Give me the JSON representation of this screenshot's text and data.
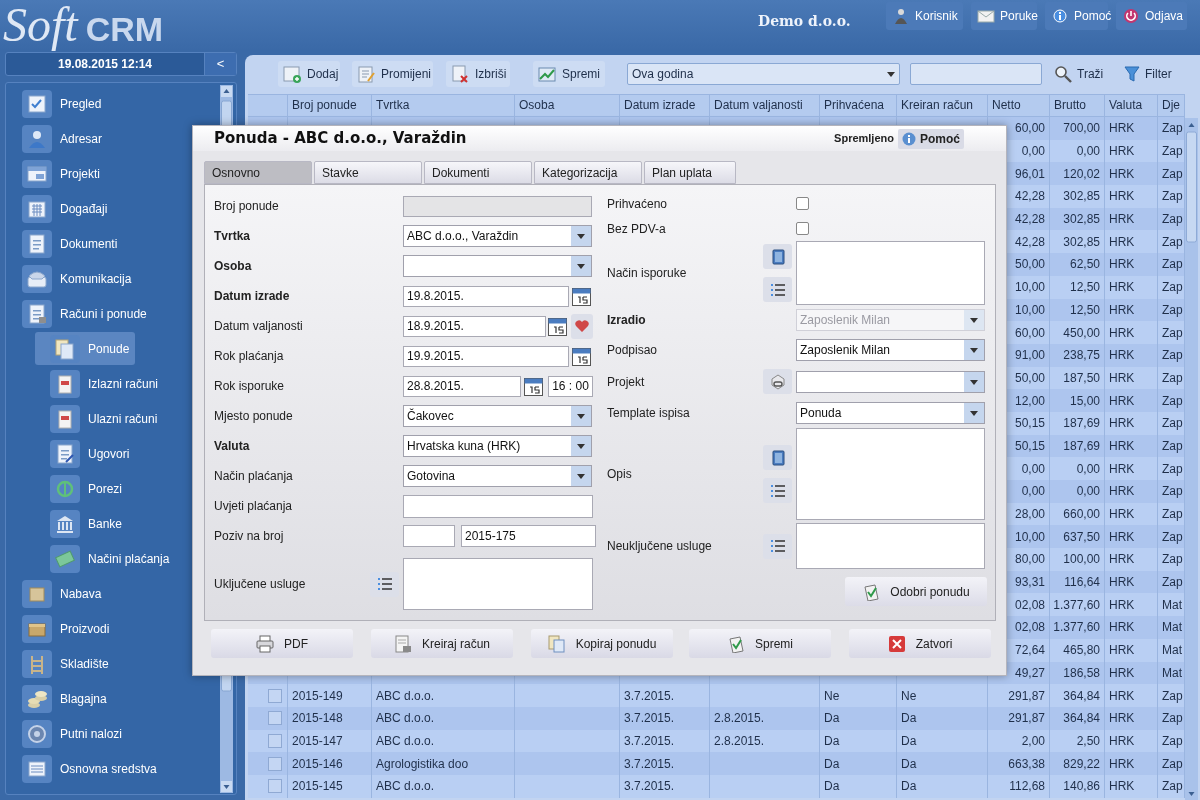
{
  "header": {
    "logo_first": "Soft",
    "logo_second": "CRM",
    "company": "Demo d.o.o.",
    "buttons": [
      "Korisnik",
      "Poruke",
      "Pomoć",
      "Odjava"
    ]
  },
  "sidebar": {
    "datetime": "19.08.2015 12:14",
    "collapse": "<",
    "items": [
      {
        "label": "Pregled",
        "selected": false
      },
      {
        "label": "Adresar",
        "selected": false
      },
      {
        "label": "Projekti",
        "selected": false
      },
      {
        "label": "Događaji",
        "selected": false
      },
      {
        "label": "Dokumenti",
        "selected": false
      },
      {
        "label": "Komunikacija",
        "selected": false
      },
      {
        "label": "Računi i ponude",
        "selected": false,
        "children": [
          {
            "label": "Ponude",
            "selected": true
          },
          {
            "label": "Izlazni računi",
            "selected": false
          },
          {
            "label": "Ulazni računi",
            "selected": false
          },
          {
            "label": "Ugovori",
            "selected": false
          },
          {
            "label": "Porezi",
            "selected": false
          },
          {
            "label": "Banke",
            "selected": false
          },
          {
            "label": "Načini plaćanja",
            "selected": false
          }
        ]
      },
      {
        "label": "Nabava",
        "selected": false
      },
      {
        "label": "Proizvodi",
        "selected": false
      },
      {
        "label": "Skladište",
        "selected": false
      },
      {
        "label": "Blagajna",
        "selected": false
      },
      {
        "label": "Putni nalozi",
        "selected": false
      },
      {
        "label": "Osnovna sredstva",
        "selected": false
      }
    ]
  },
  "toolbar": {
    "buttons": [
      "Dodaj",
      "Promijeni",
      "Izbriši",
      "Spremi"
    ],
    "period": "Ova godina",
    "search_button": "Traži",
    "filter_button": "Filter"
  },
  "table": {
    "columns": [
      "Broj ponude",
      "Tvrtka",
      "Osoba",
      "Datum izrade",
      "Datum valjanosti",
      "Prihvaćena",
      "Kreiran račun",
      "Netto",
      "Brutto",
      "Valuta",
      "Dje"
    ],
    "rows": [
      {
        "netto": "60,00",
        "brutto": "700,00",
        "valuta": "HRK",
        "dje": "Zap"
      },
      {
        "netto": "0,00",
        "brutto": "0,00",
        "valuta": "HRK",
        "dje": "Zap"
      },
      {
        "netto": "96,01",
        "brutto": "120,02",
        "valuta": "HRK",
        "dje": "Zap"
      },
      {
        "netto": "42,28",
        "brutto": "302,85",
        "valuta": "HRK",
        "dje": "Zap"
      },
      {
        "netto": "42,28",
        "brutto": "302,85",
        "valuta": "HRK",
        "dje": "Zap"
      },
      {
        "netto": "42,28",
        "brutto": "302,85",
        "valuta": "HRK",
        "dje": "Zap"
      },
      {
        "netto": "50,00",
        "brutto": "62,50",
        "valuta": "HRK",
        "dje": "Zap"
      },
      {
        "netto": "10,00",
        "brutto": "12,50",
        "valuta": "HRK",
        "dje": "Zap"
      },
      {
        "netto": "10,00",
        "brutto": "12,50",
        "valuta": "HRK",
        "dje": "Zap"
      },
      {
        "netto": "60,00",
        "brutto": "450,00",
        "valuta": "HRK",
        "dje": "Zap"
      },
      {
        "netto": "91,00",
        "brutto": "238,75",
        "valuta": "HRK",
        "dje": "Zap"
      },
      {
        "netto": "50,00",
        "brutto": "187,50",
        "valuta": "HRK",
        "dje": "Zap"
      },
      {
        "netto": "12,00",
        "brutto": "15,00",
        "valuta": "HRK",
        "dje": "Zap"
      },
      {
        "netto": "50,15",
        "brutto": "187,69",
        "valuta": "HRK",
        "dje": "Zap"
      },
      {
        "netto": "50,15",
        "brutto": "187,69",
        "valuta": "HRK",
        "dje": "Zap"
      },
      {
        "netto": "0,00",
        "brutto": "0,00",
        "valuta": "HRK",
        "dje": "Zap"
      },
      {
        "netto": "0,00",
        "brutto": "0,00",
        "valuta": "HRK",
        "dje": "Zap"
      },
      {
        "netto": "28,00",
        "brutto": "660,00",
        "valuta": "HRK",
        "dje": "Zap"
      },
      {
        "netto": "10,00",
        "brutto": "637,50",
        "valuta": "HRK",
        "dje": "Zap"
      },
      {
        "netto": "80,00",
        "brutto": "100,00",
        "valuta": "HRK",
        "dje": "Zap"
      },
      {
        "netto": "93,31",
        "brutto": "116,64",
        "valuta": "HRK",
        "dje": "Zap"
      },
      {
        "netto": "02,08",
        "brutto": "1.377,60",
        "valuta": "HRK",
        "dje": "Mat"
      },
      {
        "netto": "02,08",
        "brutto": "1.377,60",
        "valuta": "HRK",
        "dje": "Mat"
      },
      {
        "netto": "72,64",
        "brutto": "465,80",
        "valuta": "HRK",
        "dje": "Mat"
      },
      {
        "netto": "49,27",
        "brutto": "186,58",
        "valuta": "HRK",
        "dje": "Mat"
      },
      {
        "checked": false,
        "broj": "2015-149",
        "tvrtka": "ABC d.o.o.",
        "datum_izrade": "3.7.2015.",
        "prihvacena": "Ne",
        "kreiran_racun": "Ne",
        "netto": "291,87",
        "brutto": "364,84",
        "valuta": "HRK",
        "dje": "Zap"
      },
      {
        "checked": false,
        "broj": "2015-148",
        "tvrtka": "ABC d.o.o.",
        "datum_izrade": "3.7.2015.",
        "datum_valjanosti": "2.8.2015.",
        "prihvacena": "Da",
        "kreiran_racun": "Da",
        "netto": "291,87",
        "brutto": "364,84",
        "valuta": "HRK",
        "dje": "Zap"
      },
      {
        "checked": false,
        "broj": "2015-147",
        "tvrtka": "ABC d.o.o.",
        "datum_izrade": "3.7.2015.",
        "datum_valjanosti": "2.8.2015.",
        "prihvacena": "Da",
        "kreiran_racun": "Da",
        "netto": "2,00",
        "brutto": "2,50",
        "valuta": "HRK",
        "dje": "Zap"
      },
      {
        "checked": false,
        "broj": "2015-146",
        "tvrtka": "Agrologistika doo",
        "datum_izrade": "3.7.2015.",
        "prihvacena": "Da",
        "kreiran_racun": "Da",
        "netto": "663,38",
        "brutto": "829,22",
        "valuta": "HRK",
        "dje": "Zap"
      },
      {
        "checked": false,
        "broj": "2015-145",
        "tvrtka": "ABC d.o.o.",
        "datum_izrade": "3.7.2015.",
        "prihvacena": "Da",
        "kreiran_racun": "Da",
        "netto": "112,68",
        "brutto": "140,86",
        "valuta": "HRK",
        "dje": "Zap"
      }
    ]
  },
  "dialog": {
    "title": "Ponuda - ABC d.o.o., Varaždin",
    "status": "Spremljeno",
    "help": "Pomoć",
    "tabs": [
      {
        "label": "Osnovno",
        "selected": true
      },
      {
        "label": "Stavke",
        "selected": false
      },
      {
        "label": "Dokumenti",
        "selected": false
      },
      {
        "label": "Kategorizacija",
        "selected": false
      },
      {
        "label": "Plan uplata",
        "selected": false
      }
    ],
    "left_fields": [
      {
        "label": "Broj ponude",
        "required": false,
        "kind": "readonly"
      },
      {
        "label": "Tvrtka",
        "required": true,
        "kind": "select",
        "value": "ABC d.o.o., Varaždin"
      },
      {
        "label": "Osoba",
        "required": true,
        "kind": "select"
      },
      {
        "label": "Datum izrade",
        "required": true,
        "kind": "date",
        "value": "19.8.2015."
      },
      {
        "label": "Datum valjanosti",
        "required": false,
        "kind": "date_reset",
        "value": "18.9.2015."
      },
      {
        "label": "Rok plaćanja",
        "required": false,
        "kind": "date",
        "value": "19.9.2015."
      },
      {
        "label": "Rok isporuke",
        "required": false,
        "kind": "datetime",
        "value": "28.8.2015.",
        "time": "16 : 00"
      },
      {
        "label": "Mjesto ponude",
        "required": false,
        "kind": "select",
        "value": "Čakovec"
      },
      {
        "label": "Valuta",
        "required": true,
        "kind": "select",
        "value": "Hrvatska kuna (HRK)"
      },
      {
        "label": "Način plaćanja",
        "required": false,
        "kind": "select",
        "value": "Gotovina"
      },
      {
        "label": "Uvjeti plaćanja",
        "required": false,
        "kind": "text"
      },
      {
        "label": "Poziv na broj",
        "required": false,
        "kind": "pair",
        "value": "2015-175"
      },
      {
        "label": "Uključene usluge",
        "required": false,
        "kind": "memo"
      }
    ],
    "right_fields": [
      {
        "label": "Prihvaćeno",
        "required": false,
        "kind": "checkbox",
        "checked": false
      },
      {
        "label": "Bez PDV-a",
        "required": false,
        "kind": "checkbox",
        "checked": false
      },
      {
        "label": "Način isporuke",
        "required": false,
        "kind": "notes"
      },
      {
        "label": "Izradio",
        "required": true,
        "kind": "select",
        "value": "Zaposlenik Milan",
        "disabled": true
      },
      {
        "label": "Podpisao",
        "required": false,
        "kind": "select",
        "value": "Zaposlenik Milan",
        "disabled": false
      },
      {
        "label": "Projekt",
        "required": false,
        "kind": "select_link"
      },
      {
        "label": "Template ispisa",
        "required": false,
        "kind": "select",
        "value": "Ponuda",
        "disabled": false
      },
      {
        "label": "Opis",
        "required": false,
        "kind": "notes"
      },
      {
        "label": "Neuključene usluge",
        "required": false,
        "kind": "memo"
      }
    ],
    "approve_button": "Odobri ponudu",
    "buttons": [
      "PDF",
      "Kreiraj račun",
      "Kopiraj ponudu",
      "Spremi",
      "Zatvori"
    ]
  }
}
